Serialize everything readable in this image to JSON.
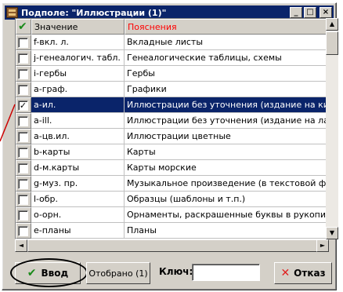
{
  "window": {
    "title": "Подполе: \"Иллюстрации (1)\"",
    "minimize": "_",
    "maximize": "□",
    "close": "×"
  },
  "grid": {
    "columns": [
      "✔",
      "Значение",
      "Пояснения"
    ],
    "rows": [
      {
        "checked": false,
        "code": "f-вкл. л.",
        "desc": "Вкладные листы"
      },
      {
        "checked": false,
        "code": "j-генеалогич. табл.",
        "desc": "Генеалогические таблицы, схемы"
      },
      {
        "checked": false,
        "code": "i-гербы",
        "desc": "Гербы"
      },
      {
        "checked": false,
        "code": "a-граф.",
        "desc": "Графики"
      },
      {
        "checked": true,
        "selected": true,
        "code": "a-ил.",
        "desc": "Иллюстрации без уточнения (издание на кириллице)"
      },
      {
        "checked": false,
        "code": "a-ill.",
        "desc": "Иллюстрации без уточнения (издание на латинице)"
      },
      {
        "checked": false,
        "code": "a-цв.ил.",
        "desc": "Иллюстрации цветные"
      },
      {
        "checked": false,
        "code": "b-карты",
        "desc": "Карты"
      },
      {
        "checked": false,
        "code": "d-м.карты",
        "desc": "Карты морские"
      },
      {
        "checked": false,
        "code": "g-муз. пр.",
        "desc": "Музыкальное произведение (в текстовой форме)"
      },
      {
        "checked": false,
        "code": "l-обр.",
        "desc": "Образцы (шаблоны и т.п.)"
      },
      {
        "checked": false,
        "code": "o-орн.",
        "desc": "Орнаменты, раскрашенные буквы в рукописи"
      },
      {
        "checked": false,
        "code": "e-планы",
        "desc": "Планы"
      }
    ]
  },
  "footer": {
    "ok_label": "Ввод",
    "selected_label": "Отобрано (1)",
    "key_label": "Ключ:",
    "key_value": "",
    "cancel_label": "Отказ"
  },
  "colors": {
    "titlebar": "#0a246a",
    "selection": "#0a246a",
    "header_desc": "#ff0000",
    "check_green": "#1a8a1a",
    "cancel_red": "#e02020",
    "annotation": "#cc0000"
  }
}
